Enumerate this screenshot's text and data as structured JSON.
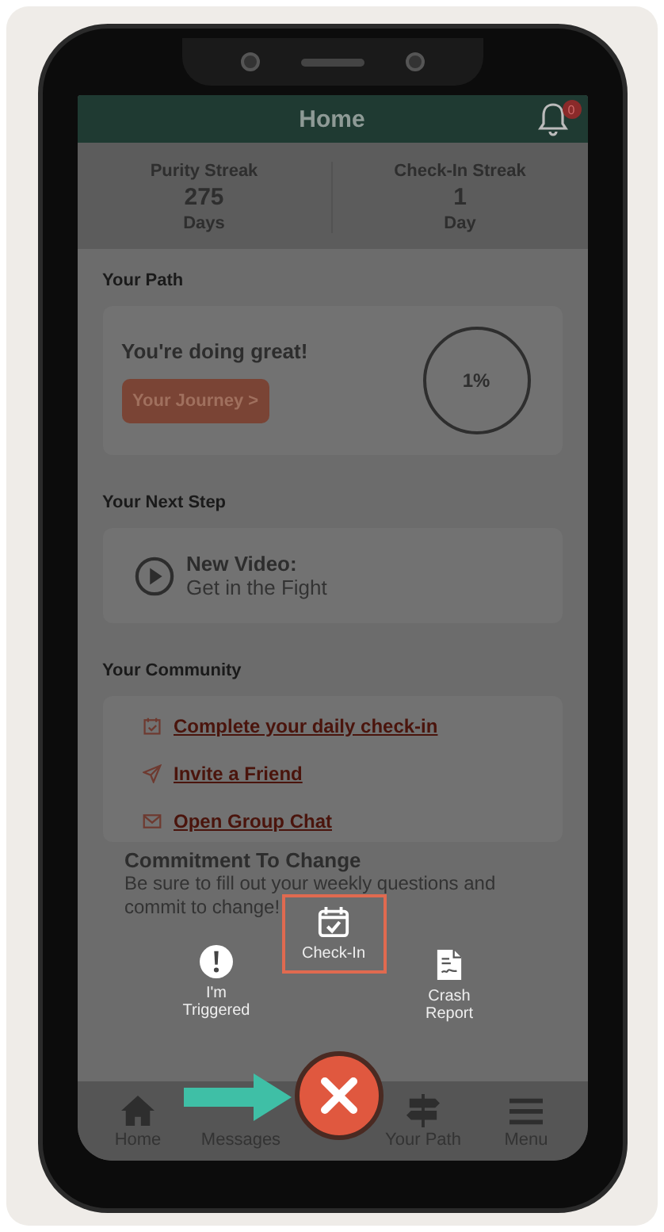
{
  "header": {
    "title": "Home",
    "notification_badge": "0"
  },
  "streaks": [
    {
      "label": "Purity Streak",
      "value": "275",
      "unit": "Days"
    },
    {
      "label": "Check-In Streak",
      "value": "1",
      "unit": "Day"
    }
  ],
  "path": {
    "heading": "Your Path",
    "message": "You're doing great!",
    "button": "Your Journey >",
    "progress": "1%"
  },
  "next_step": {
    "heading": "Your Next Step",
    "title": "New Video:",
    "subtitle": "Get in the Fight"
  },
  "community": {
    "heading": "Your Community",
    "links": [
      {
        "kind": "calendar",
        "label": "Complete your daily check-in"
      },
      {
        "kind": "send",
        "label": "Invite a Friend"
      },
      {
        "kind": "mail",
        "label": "Open Group Chat"
      }
    ]
  },
  "commitment": {
    "title": "Commitment To Change",
    "text": "Be sure to fill out your weekly questions and commit to change!"
  },
  "quick_actions": [
    {
      "kind": "alert",
      "label": "I'm Triggered",
      "selected": false
    },
    {
      "kind": "checkin",
      "label": "Check-In",
      "selected": true
    },
    {
      "kind": "report",
      "label": "Crash Report",
      "selected": false
    }
  ],
  "nav": [
    {
      "kind": "home",
      "label": "Home"
    },
    {
      "kind": "messages",
      "label": "Messages"
    },
    {
      "kind": "close"
    },
    {
      "kind": "path",
      "label": "Your Path"
    },
    {
      "kind": "menu",
      "label": "Menu"
    }
  ]
}
